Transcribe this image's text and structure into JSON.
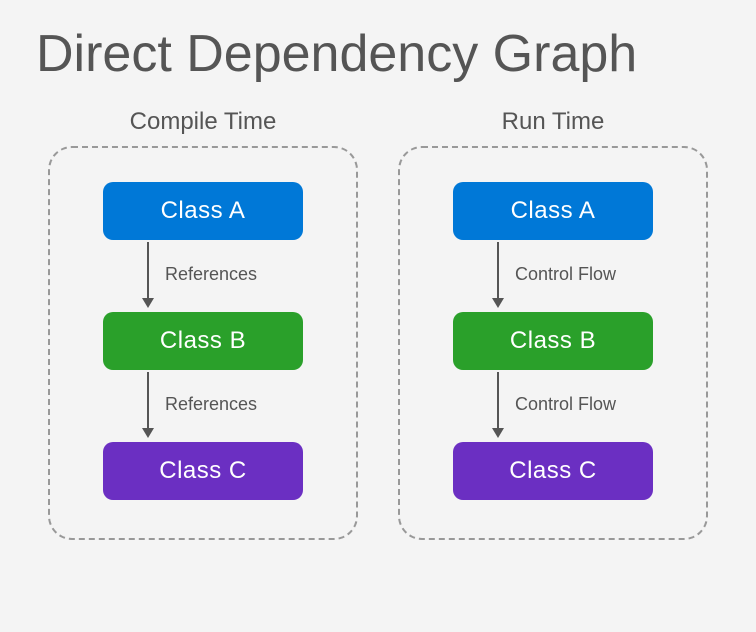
{
  "title": "Direct Dependency Graph",
  "colors": {
    "classA": "#0078d7",
    "classB": "#2aa02a",
    "classC": "#6b2fc2"
  },
  "panels": [
    {
      "title": "Compile Time",
      "nodes": [
        "Class A",
        "Class B",
        "Class C"
      ],
      "edges": [
        "References",
        "References"
      ]
    },
    {
      "title": "Run Time",
      "nodes": [
        "Class A",
        "Class B",
        "Class C"
      ],
      "edges": [
        "Control Flow",
        "Control Flow"
      ]
    }
  ]
}
